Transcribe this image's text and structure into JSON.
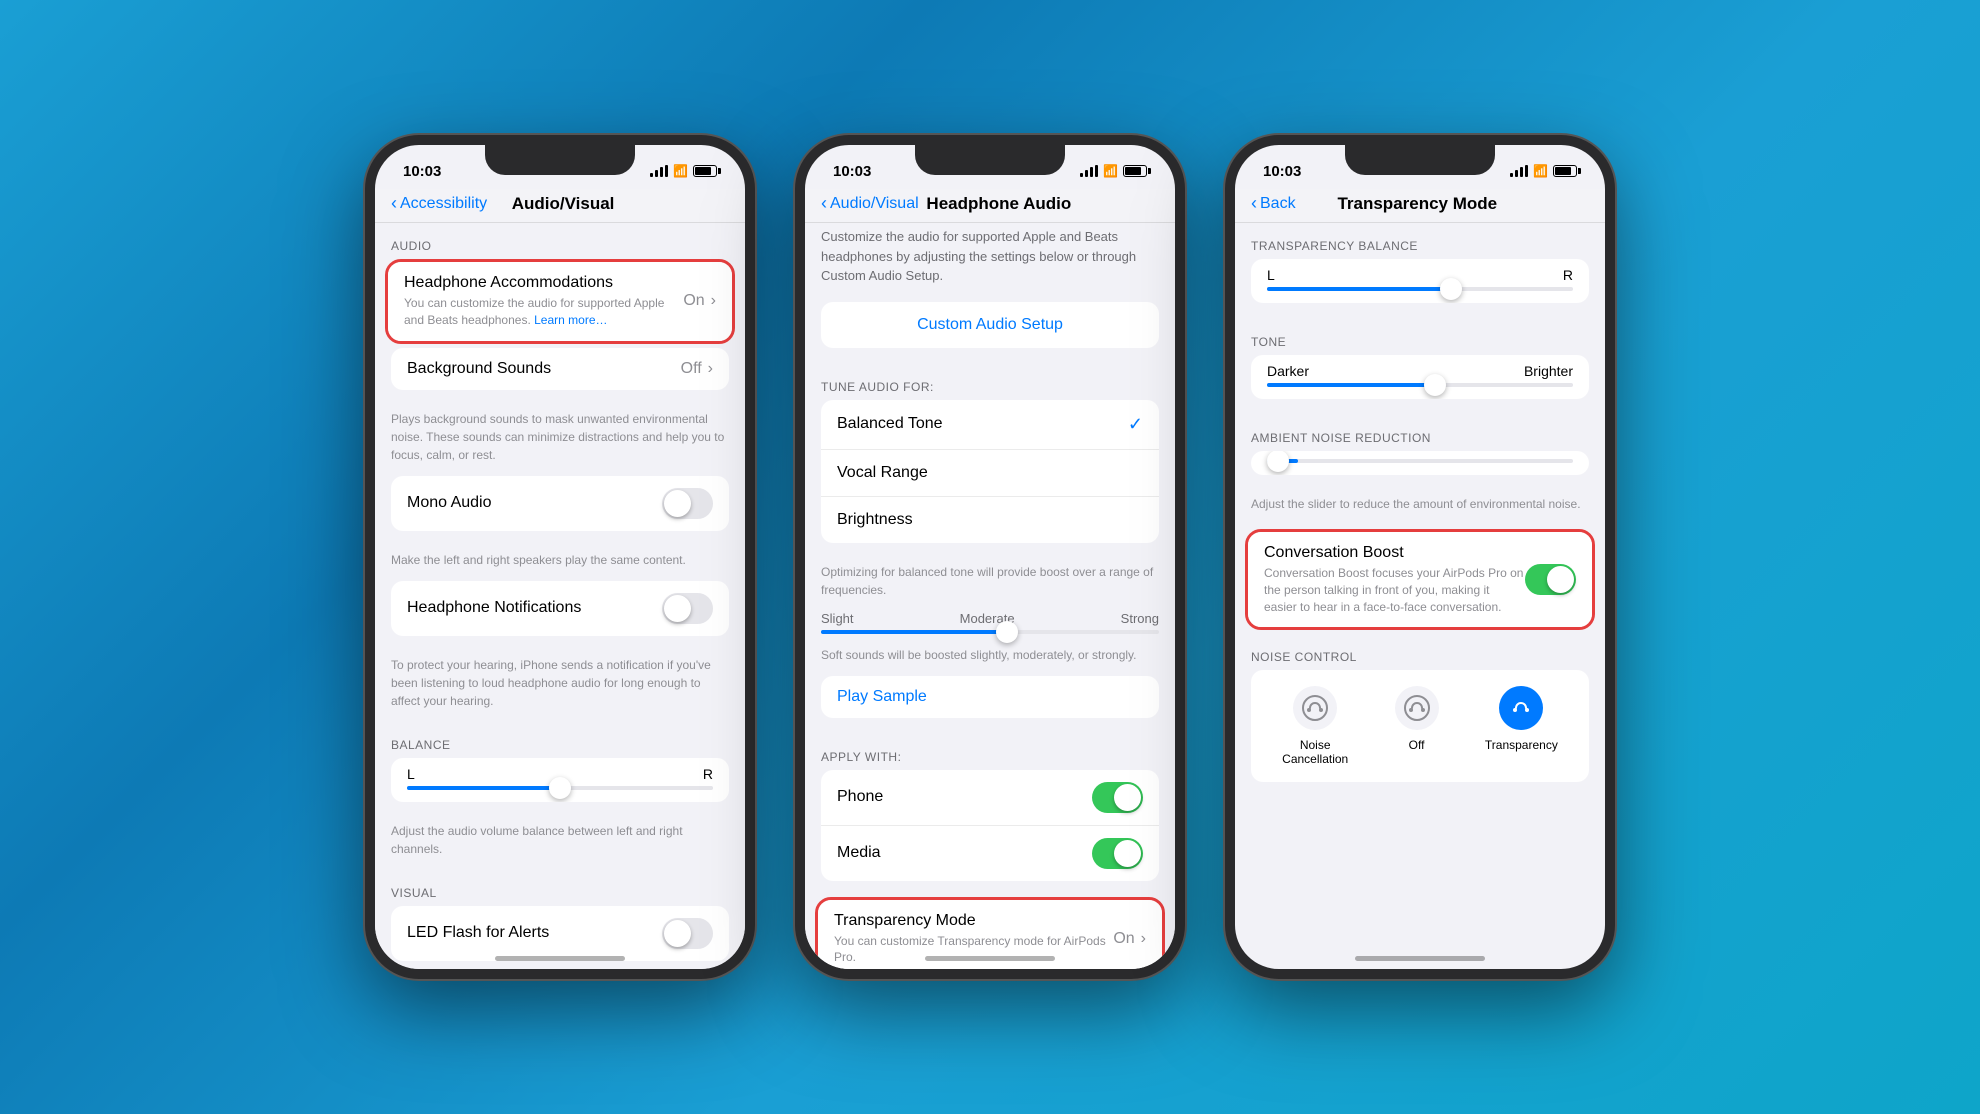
{
  "phone1": {
    "statusBar": {
      "time": "10:03",
      "location": true
    },
    "navBar": {
      "backLabel": "Accessibility",
      "title": "Audio/Visual"
    },
    "sections": {
      "audio": {
        "label": "AUDIO",
        "headphoneAccommodations": {
          "title": "Headphone Accommodations",
          "value": "On",
          "subtitle": "You can customize the audio for supported Apple and Beats headphones.",
          "linkText": "Learn more…",
          "highlighted": true
        },
        "backgroundSounds": {
          "title": "Background Sounds",
          "value": "Off"
        },
        "backgroundDesc": "Plays background sounds to mask unwanted environmental noise. These sounds can minimize distractions and help you to focus, calm, or rest.",
        "monoAudio": {
          "title": "Mono Audio",
          "toggleState": "off"
        },
        "monoDesc": "Make the left and right speakers play the same content.",
        "headphoneNotifications": {
          "title": "Headphone Notifications",
          "toggleState": "off"
        },
        "headphoneNotifDesc": "To protect your hearing, iPhone sends a notification if you've been listening to loud headphone audio for long enough to affect your hearing."
      },
      "balance": {
        "label": "BALANCE",
        "left": "L",
        "right": "R",
        "position": 50,
        "desc": "Adjust the audio volume balance between left and right channels."
      },
      "visual": {
        "label": "VISUAL",
        "ledFlash": {
          "title": "LED Flash for Alerts",
          "toggleState": "off"
        }
      }
    }
  },
  "phone2": {
    "statusBar": {
      "time": "10:03"
    },
    "navBar": {
      "backLabel": "Audio/Visual",
      "title": "Headphone Audio"
    },
    "scrollDesc": "Customize the audio for supported Apple and Beats headphones by adjusting the settings below or through Custom Audio Setup.",
    "customAudio": "Custom Audio Setup",
    "tuneFor": "TUNE AUDIO FOR:",
    "tuneOptions": [
      {
        "label": "Balanced Tone",
        "selected": true
      },
      {
        "label": "Vocal Range",
        "selected": false
      },
      {
        "label": "Brightness",
        "selected": false
      }
    ],
    "tuneDesc": "Optimizing for balanced tone will provide boost over a range of frequencies.",
    "strengthLabels": {
      "slight": "Slight",
      "moderate": "Moderate",
      "strong": "Strong"
    },
    "sliderPosition": 55,
    "boostDesc": "Soft sounds will be boosted slightly, moderately, or strongly.",
    "playSample": "Play Sample",
    "applyWith": "APPLY WITH:",
    "applyOptions": [
      {
        "label": "Phone",
        "toggleState": "on"
      },
      {
        "label": "Media",
        "toggleState": "on"
      }
    ],
    "transparencyMode": {
      "title": "Transparency Mode",
      "value": "On",
      "subtitle": "You can customize Transparency mode for AirPods Pro.",
      "highlighted": true
    }
  },
  "phone3": {
    "statusBar": {
      "time": "10:03"
    },
    "navBar": {
      "backLabel": "Back",
      "title": "Transparency Mode"
    },
    "transparencyBalance": {
      "label": "TRANSPARENCY BALANCE",
      "left": "L",
      "right": "R",
      "position": 60
    },
    "tone": {
      "label": "TONE",
      "left": "Darker",
      "right": "Brighter",
      "position": 55
    },
    "ambientNoise": {
      "label": "AMBIENT NOISE REDUCTION",
      "position": 10,
      "desc": "Adjust the slider to reduce the amount of environmental noise."
    },
    "conversationBoost": {
      "title": "Conversation Boost",
      "toggleState": "on",
      "desc": "Conversation Boost focuses your AirPods Pro on the person talking in front of you, making it easier to hear in a face-to-face conversation.",
      "highlighted": true
    },
    "noiseControl": {
      "label": "NOISE CONTROL",
      "options": [
        {
          "label": "Noise Cancellation",
          "icon": "🎧",
          "active": false
        },
        {
          "label": "Off",
          "icon": "🎧",
          "active": false
        },
        {
          "label": "Transparency",
          "icon": "🎧",
          "active": true
        }
      ]
    }
  }
}
